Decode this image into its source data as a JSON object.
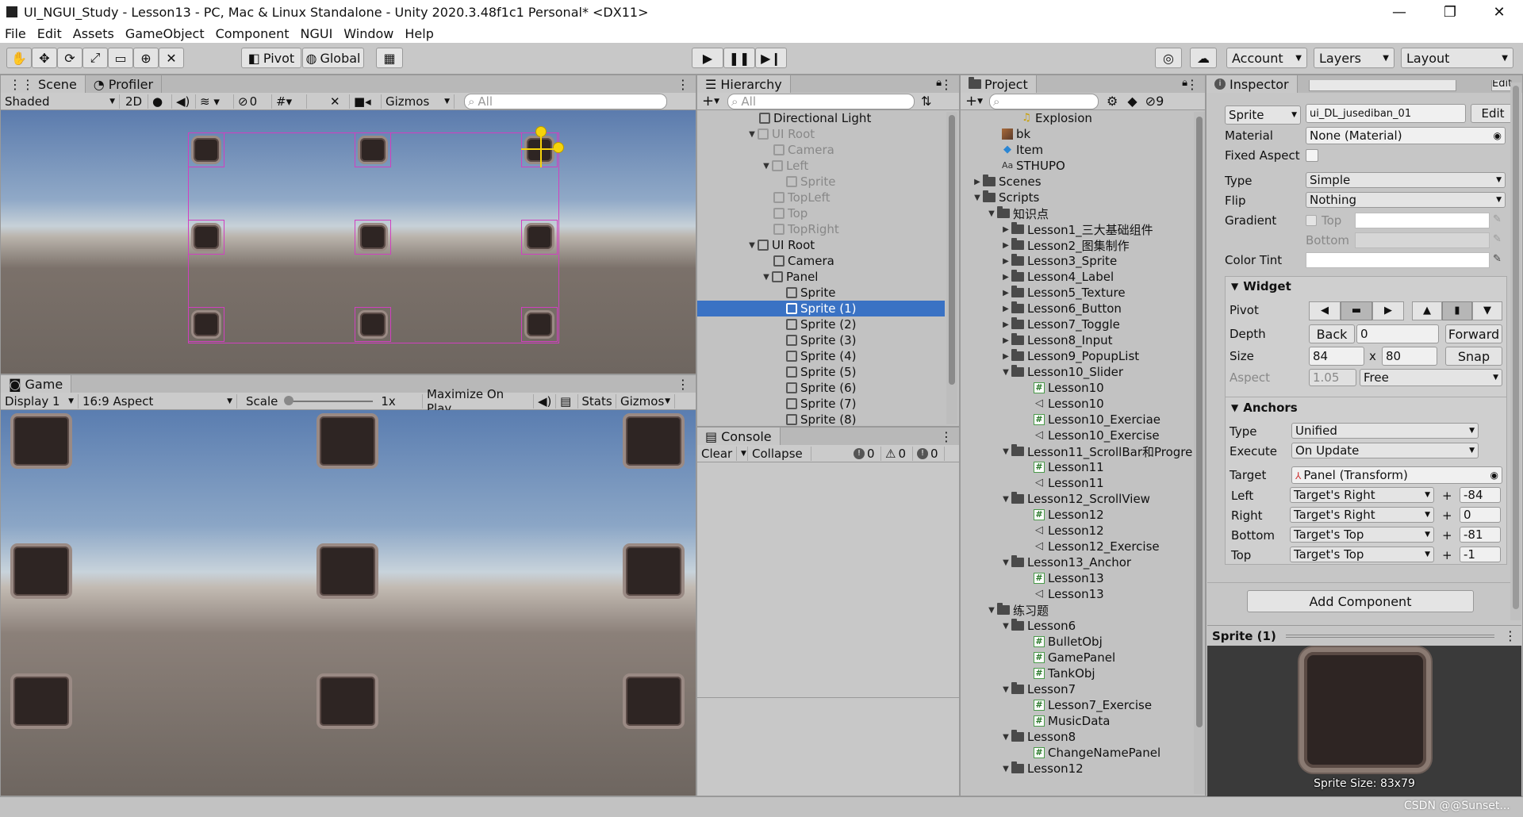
{
  "window": {
    "title": "UI_NGUI_Study - Lesson13 - PC, Mac & Linux Standalone - Unity 2020.3.48f1c1 Personal* <DX11>",
    "minimize": "—",
    "maximize": "❐",
    "close": "✕"
  },
  "menu": [
    "File",
    "Edit",
    "Assets",
    "GameObject",
    "Component",
    "NGUI",
    "Window",
    "Help"
  ],
  "toolbar": {
    "pivot": "Pivot",
    "global": "Global",
    "account": "Account",
    "layers": "Layers",
    "layout": "Layout"
  },
  "scene": {
    "tab": "Scene",
    "tab2": "Profiler",
    "shading": "Shaded",
    "mode2d": "2D",
    "hidden_count": "0",
    "gizmos": "Gizmos",
    "search_placeholder": "All"
  },
  "game": {
    "tab": "Game",
    "display": "Display 1",
    "aspect": "16:9 Aspect",
    "scale_label": "Scale",
    "scale_value": "1x",
    "maximize": "Maximize On Play",
    "stats": "Stats",
    "gizmos": "Gizmos"
  },
  "hierarchy": {
    "tab": "Hierarchy",
    "search_placeholder": "All",
    "items": [
      {
        "label": "Directional Light",
        "dim": false
      },
      {
        "label": "UI Root",
        "dim": true
      },
      {
        "label": "Camera",
        "dim": true
      },
      {
        "label": "Left",
        "dim": true
      },
      {
        "label": "Sprite",
        "dim": true
      },
      {
        "label": "TopLeft",
        "dim": true
      },
      {
        "label": "Top",
        "dim": true
      },
      {
        "label": "TopRight",
        "dim": true
      },
      {
        "label": "UI Root",
        "dim": false
      },
      {
        "label": "Camera",
        "dim": false
      },
      {
        "label": "Panel",
        "dim": false
      },
      {
        "label": "Sprite",
        "dim": false
      },
      {
        "label": "Sprite (1)",
        "dim": false
      },
      {
        "label": "Sprite (2)",
        "dim": false
      },
      {
        "label": "Sprite (3)",
        "dim": false
      },
      {
        "label": "Sprite (4)",
        "dim": false
      },
      {
        "label": "Sprite (5)",
        "dim": false
      },
      {
        "label": "Sprite (6)",
        "dim": false
      },
      {
        "label": "Sprite (7)",
        "dim": false
      },
      {
        "label": "Sprite (8)",
        "dim": false
      }
    ]
  },
  "console": {
    "tab": "Console",
    "clear": "Clear",
    "collapse": "Collapse",
    "info_count": "0",
    "warn_count": "0",
    "error_count": "0"
  },
  "project": {
    "tab": "Project",
    "hidden_count": "9",
    "items": [
      {
        "label": "Explosion",
        "icon": "audio"
      },
      {
        "label": "bk",
        "icon": "image"
      },
      {
        "label": "Item",
        "icon": "prefab"
      },
      {
        "label": "STHUPO",
        "icon": "font"
      },
      {
        "label": "Scenes",
        "icon": "folder"
      },
      {
        "label": "Scripts",
        "icon": "folder"
      },
      {
        "label": "知识点",
        "icon": "folder"
      },
      {
        "label": "Lesson1_三大基础组件",
        "icon": "folder"
      },
      {
        "label": "Lesson2_图集制作",
        "icon": "folder"
      },
      {
        "label": "Lesson3_Sprite",
        "icon": "folder"
      },
      {
        "label": "Lesson4_Label",
        "icon": "folder"
      },
      {
        "label": "Lesson5_Texture",
        "icon": "folder"
      },
      {
        "label": "Lesson6_Button",
        "icon": "folder"
      },
      {
        "label": "Lesson7_Toggle",
        "icon": "folder"
      },
      {
        "label": "Lesson8_Input",
        "icon": "folder"
      },
      {
        "label": "Lesson9_PopupList",
        "icon": "folder"
      },
      {
        "label": "Lesson10_Slider",
        "icon": "folder"
      },
      {
        "label": "Lesson10",
        "icon": "script"
      },
      {
        "label": "Lesson10",
        "icon": "unity"
      },
      {
        "label": "Lesson10_Exerciae",
        "icon": "script"
      },
      {
        "label": "Lesson10_Exercise",
        "icon": "unity"
      },
      {
        "label": "Lesson11_ScrollBar和Progre",
        "icon": "folder"
      },
      {
        "label": "Lesson11",
        "icon": "script"
      },
      {
        "label": "Lesson11",
        "icon": "unity"
      },
      {
        "label": "Lesson12_ScrollView",
        "icon": "folder"
      },
      {
        "label": "Lesson12",
        "icon": "script"
      },
      {
        "label": "Lesson12",
        "icon": "unity"
      },
      {
        "label": "Lesson12_Exercise",
        "icon": "unity"
      },
      {
        "label": "Lesson13_Anchor",
        "icon": "folder"
      },
      {
        "label": "Lesson13",
        "icon": "script"
      },
      {
        "label": "Lesson13",
        "icon": "unity"
      },
      {
        "label": "练习题",
        "icon": "folder"
      },
      {
        "label": "Lesson6",
        "icon": "folder"
      },
      {
        "label": "BulletObj",
        "icon": "script"
      },
      {
        "label": "GamePanel",
        "icon": "script"
      },
      {
        "label": "TankObj",
        "icon": "script"
      },
      {
        "label": "Lesson7",
        "icon": "folder"
      },
      {
        "label": "Lesson7_Exercise",
        "icon": "script"
      },
      {
        "label": "MusicData",
        "icon": "script"
      },
      {
        "label": "Lesson8",
        "icon": "folder"
      },
      {
        "label": "ChangeNamePanel",
        "icon": "script"
      },
      {
        "label": "Lesson12",
        "icon": "folder"
      }
    ]
  },
  "inspector": {
    "tab": "Inspector",
    "edit_top": "Edit",
    "sprite_dd": "Sprite",
    "sprite_name": "ui_DL_jusediban_01",
    "edit": "Edit",
    "material_label": "Material",
    "material_value": "None (Material)",
    "fixed_aspect_label": "Fixed Aspect",
    "type_label": "Type",
    "type_value": "Simple",
    "flip_label": "Flip",
    "flip_value": "Nothing",
    "gradient_label": "Gradient",
    "gradient_top": "Top",
    "gradient_bottom": "Bottom",
    "color_tint_label": "Color Tint",
    "widget_header": "Widget",
    "pivot_label": "Pivot",
    "depth_label": "Depth",
    "depth_back": "Back",
    "depth_value": "0",
    "depth_forward": "Forward",
    "size_label": "Size",
    "size_w": "84",
    "size_x": "x",
    "size_h": "80",
    "snap": "Snap",
    "aspect_label": "Aspect",
    "aspect_value": "1.05",
    "aspect_mode": "Free",
    "anchors_header": "Anchors",
    "anchor_type_label": "Type",
    "anchor_type_value": "Unified",
    "execute_label": "Execute",
    "execute_value": "On Update",
    "target_label": "Target",
    "target_value": "Panel (Transform)",
    "left_label": "Left",
    "left_dd": "Target's Right",
    "left_val": "-84",
    "right_label": "Right",
    "right_dd": "Target's Right",
    "right_val": "0",
    "bottom_label": "Bottom",
    "bottom_dd": "Target's Top",
    "bottom_val": "-81",
    "top_label": "Top",
    "top_dd": "Target's Top",
    "top_val": "-1",
    "plus": "+",
    "add_component": "Add Component",
    "preview_title": "Sprite (1)",
    "sprite_size": "Sprite Size: 83x79"
  },
  "watermark": "CSDN @@Sunset...",
  "colors": {
    "selection": "#3a72c4",
    "panel_bg": "#c2c2c2",
    "sky_top": "#5a7db0",
    "ground": "#6e6660",
    "sprite_frame": "#9a8a84",
    "sprite_fill": "#2e2523",
    "selection_rect": "#d040c0",
    "gizmo_yellow": "#f6d40a"
  }
}
